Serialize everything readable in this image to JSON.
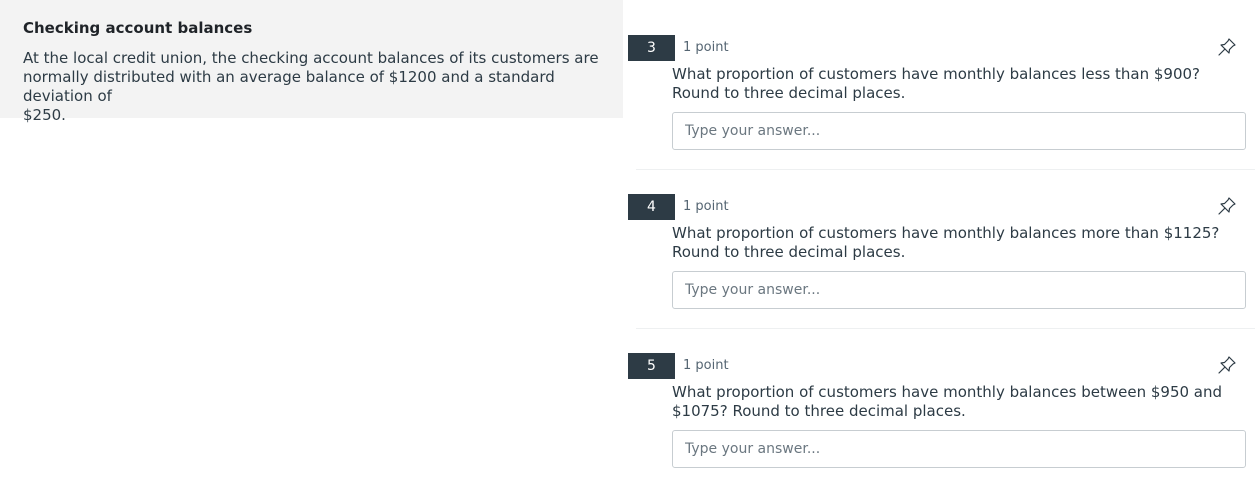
{
  "passage": {
    "title": "Checking account balances",
    "text": "At the local credit union, the checking account balances of its customers are\nnormally distributed with an average balance of $1200 and a standard deviation of\n$250."
  },
  "questions": [
    {
      "number": "3",
      "points": "1 point",
      "text": "What proportion of customers have monthly balances less than $900? Round to three decimal places.",
      "placeholder": "Type your answer..."
    },
    {
      "number": "4",
      "points": "1 point",
      "text": "What proportion of customers have monthly balances more than $1125? Round to three decimal places.",
      "placeholder": "Type your answer..."
    },
    {
      "number": "5",
      "points": "1 point",
      "text": "What proportion of customers have monthly balances between $950 and $1075? Round to three decimal places.",
      "placeholder": "Type your answer..."
    }
  ],
  "icons": {
    "pin": "pin-icon"
  },
  "colors": {
    "question_number_bg": "#2d3b45",
    "passage_bg": "#f3f3f3",
    "input_border": "#c7cdd1"
  }
}
